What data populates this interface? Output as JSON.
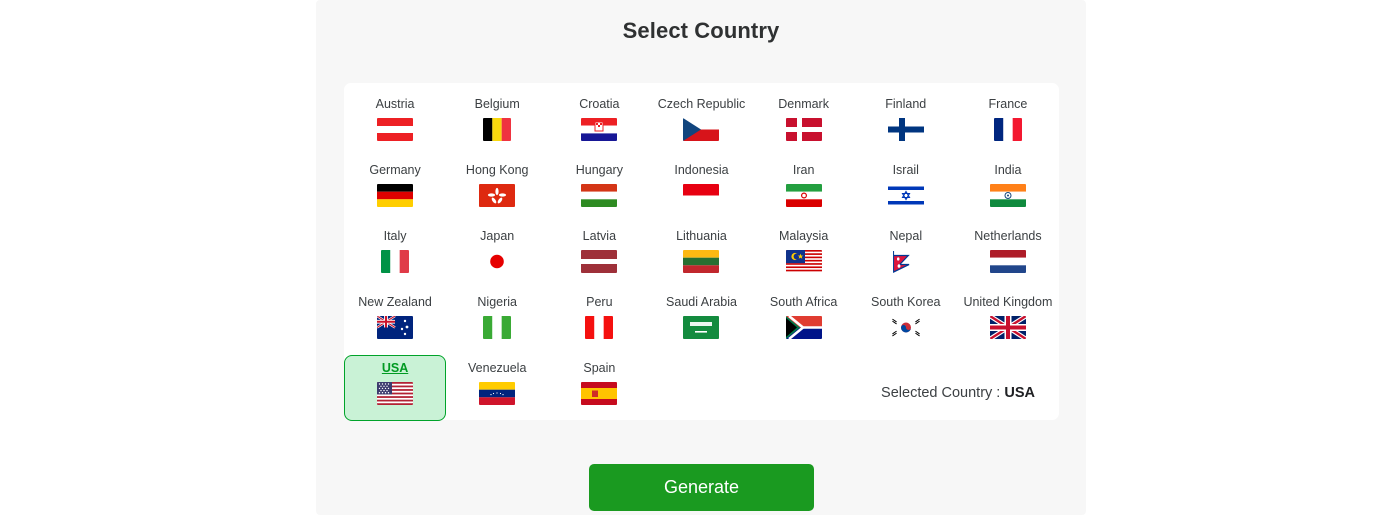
{
  "page": {
    "title": "Select Country"
  },
  "countries": [
    {
      "name": "Austria",
      "flag": "at",
      "selected": false
    },
    {
      "name": "Belgium",
      "flag": "be",
      "selected": false
    },
    {
      "name": "Croatia",
      "flag": "hr",
      "selected": false
    },
    {
      "name": "Czech Republic",
      "flag": "cz",
      "selected": false
    },
    {
      "name": "Denmark",
      "flag": "dk",
      "selected": false
    },
    {
      "name": "Finland",
      "flag": "fi",
      "selected": false
    },
    {
      "name": "France",
      "flag": "fr",
      "selected": false
    },
    {
      "name": "Germany",
      "flag": "de",
      "selected": false
    },
    {
      "name": "Hong Kong",
      "flag": "hk",
      "selected": false
    },
    {
      "name": "Hungary",
      "flag": "hu",
      "selected": false
    },
    {
      "name": "Indonesia",
      "flag": "id",
      "selected": false
    },
    {
      "name": "Iran",
      "flag": "ir",
      "selected": false
    },
    {
      "name": "Israil",
      "flag": "il",
      "selected": false
    },
    {
      "name": "India",
      "flag": "in",
      "selected": false
    },
    {
      "name": "Italy",
      "flag": "it",
      "selected": false
    },
    {
      "name": "Japan",
      "flag": "jp",
      "selected": false
    },
    {
      "name": "Latvia",
      "flag": "lv",
      "selected": false
    },
    {
      "name": "Lithuania",
      "flag": "lt",
      "selected": false
    },
    {
      "name": "Malaysia",
      "flag": "my",
      "selected": false
    },
    {
      "name": "Nepal",
      "flag": "np",
      "selected": false
    },
    {
      "name": "Netherlands",
      "flag": "nl",
      "selected": false
    },
    {
      "name": "New Zealand",
      "flag": "nz",
      "selected": false
    },
    {
      "name": "Nigeria",
      "flag": "ng",
      "selected": false
    },
    {
      "name": "Peru",
      "flag": "pe",
      "selected": false
    },
    {
      "name": "Saudi Arabia",
      "flag": "sa",
      "selected": false
    },
    {
      "name": "South Africa",
      "flag": "za",
      "selected": false
    },
    {
      "name": "South Korea",
      "flag": "kr",
      "selected": false
    },
    {
      "name": "United Kingdom",
      "flag": "gb",
      "selected": false
    },
    {
      "name": "USA",
      "flag": "us",
      "selected": true
    },
    {
      "name": "Venezuela",
      "flag": "ve",
      "selected": false
    },
    {
      "name": "Spain",
      "flag": "es",
      "selected": false
    }
  ],
  "selection": {
    "label": "Selected Country :",
    "value": "USA"
  },
  "actions": {
    "generate_label": "Generate"
  },
  "colors": {
    "panel_bg": "#f7f7f7",
    "card_bg": "#ffffff",
    "accent_green": "#1a9a20",
    "selected_bg": "#c9f2d6",
    "selected_border": "#00a32a",
    "title_text": "#2f3132"
  }
}
